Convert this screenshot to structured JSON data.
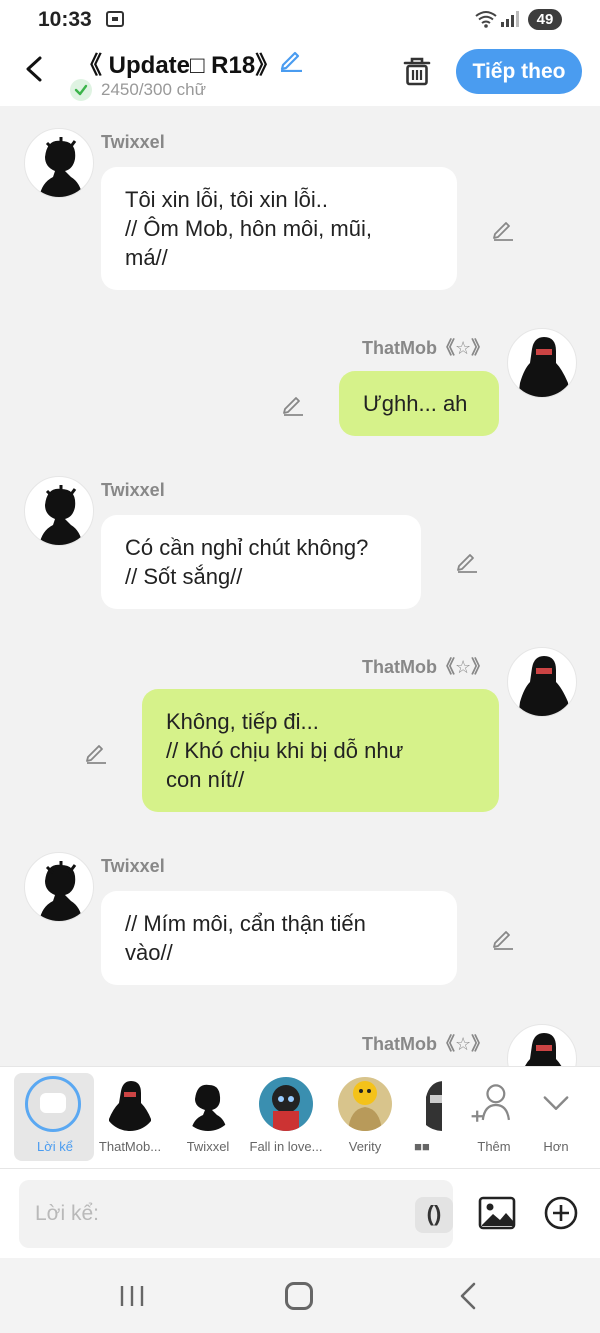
{
  "status_bar": {
    "time": "10:33",
    "battery": "49"
  },
  "header": {
    "title": "《 Update□ R18》",
    "word_count": "2450/300 chữ",
    "next_label": "Tiếp theo"
  },
  "messages": [
    {
      "side": "left",
      "name": "Twixxel",
      "text": "Tôi xin lỗi, tôi xin lỗi..\n// Ôm Mob, hôn môi, mũi,\nmá//"
    },
    {
      "side": "right",
      "name": "ThatMob《☆》",
      "text": "Ưghh... ah"
    },
    {
      "side": "left",
      "name": "Twixxel",
      "text": "Có cần nghỉ chút không?\n// Sốt sắng//"
    },
    {
      "side": "right",
      "name": "ThatMob《☆》",
      "text": "Không, tiếp đi...\n// Khó chịu khi bị dỗ như\ncon nít//"
    },
    {
      "side": "left",
      "name": "Twixxel",
      "text": "// Mím môi, cẩn thận tiến\nvào//"
    },
    {
      "side": "right",
      "name": "ThatMob《☆》",
      "text": ""
    }
  ],
  "characters": [
    {
      "label": "Lời kể"
    },
    {
      "label": "ThatMob..."
    },
    {
      "label": "Twixxel"
    },
    {
      "label": "Fall in love..."
    },
    {
      "label": "Verity"
    },
    {
      "label": "■■"
    }
  ],
  "tools": {
    "add_label": "Thêm",
    "more_label": "Hơn"
  },
  "input": {
    "placeholder": "Lời kể:",
    "paren_label": "()"
  },
  "colors": {
    "accent": "#4a9cf0",
    "right_bubble": "#d6f28a",
    "left_bubble": "#ffffff",
    "background": "#f2f2f2"
  }
}
